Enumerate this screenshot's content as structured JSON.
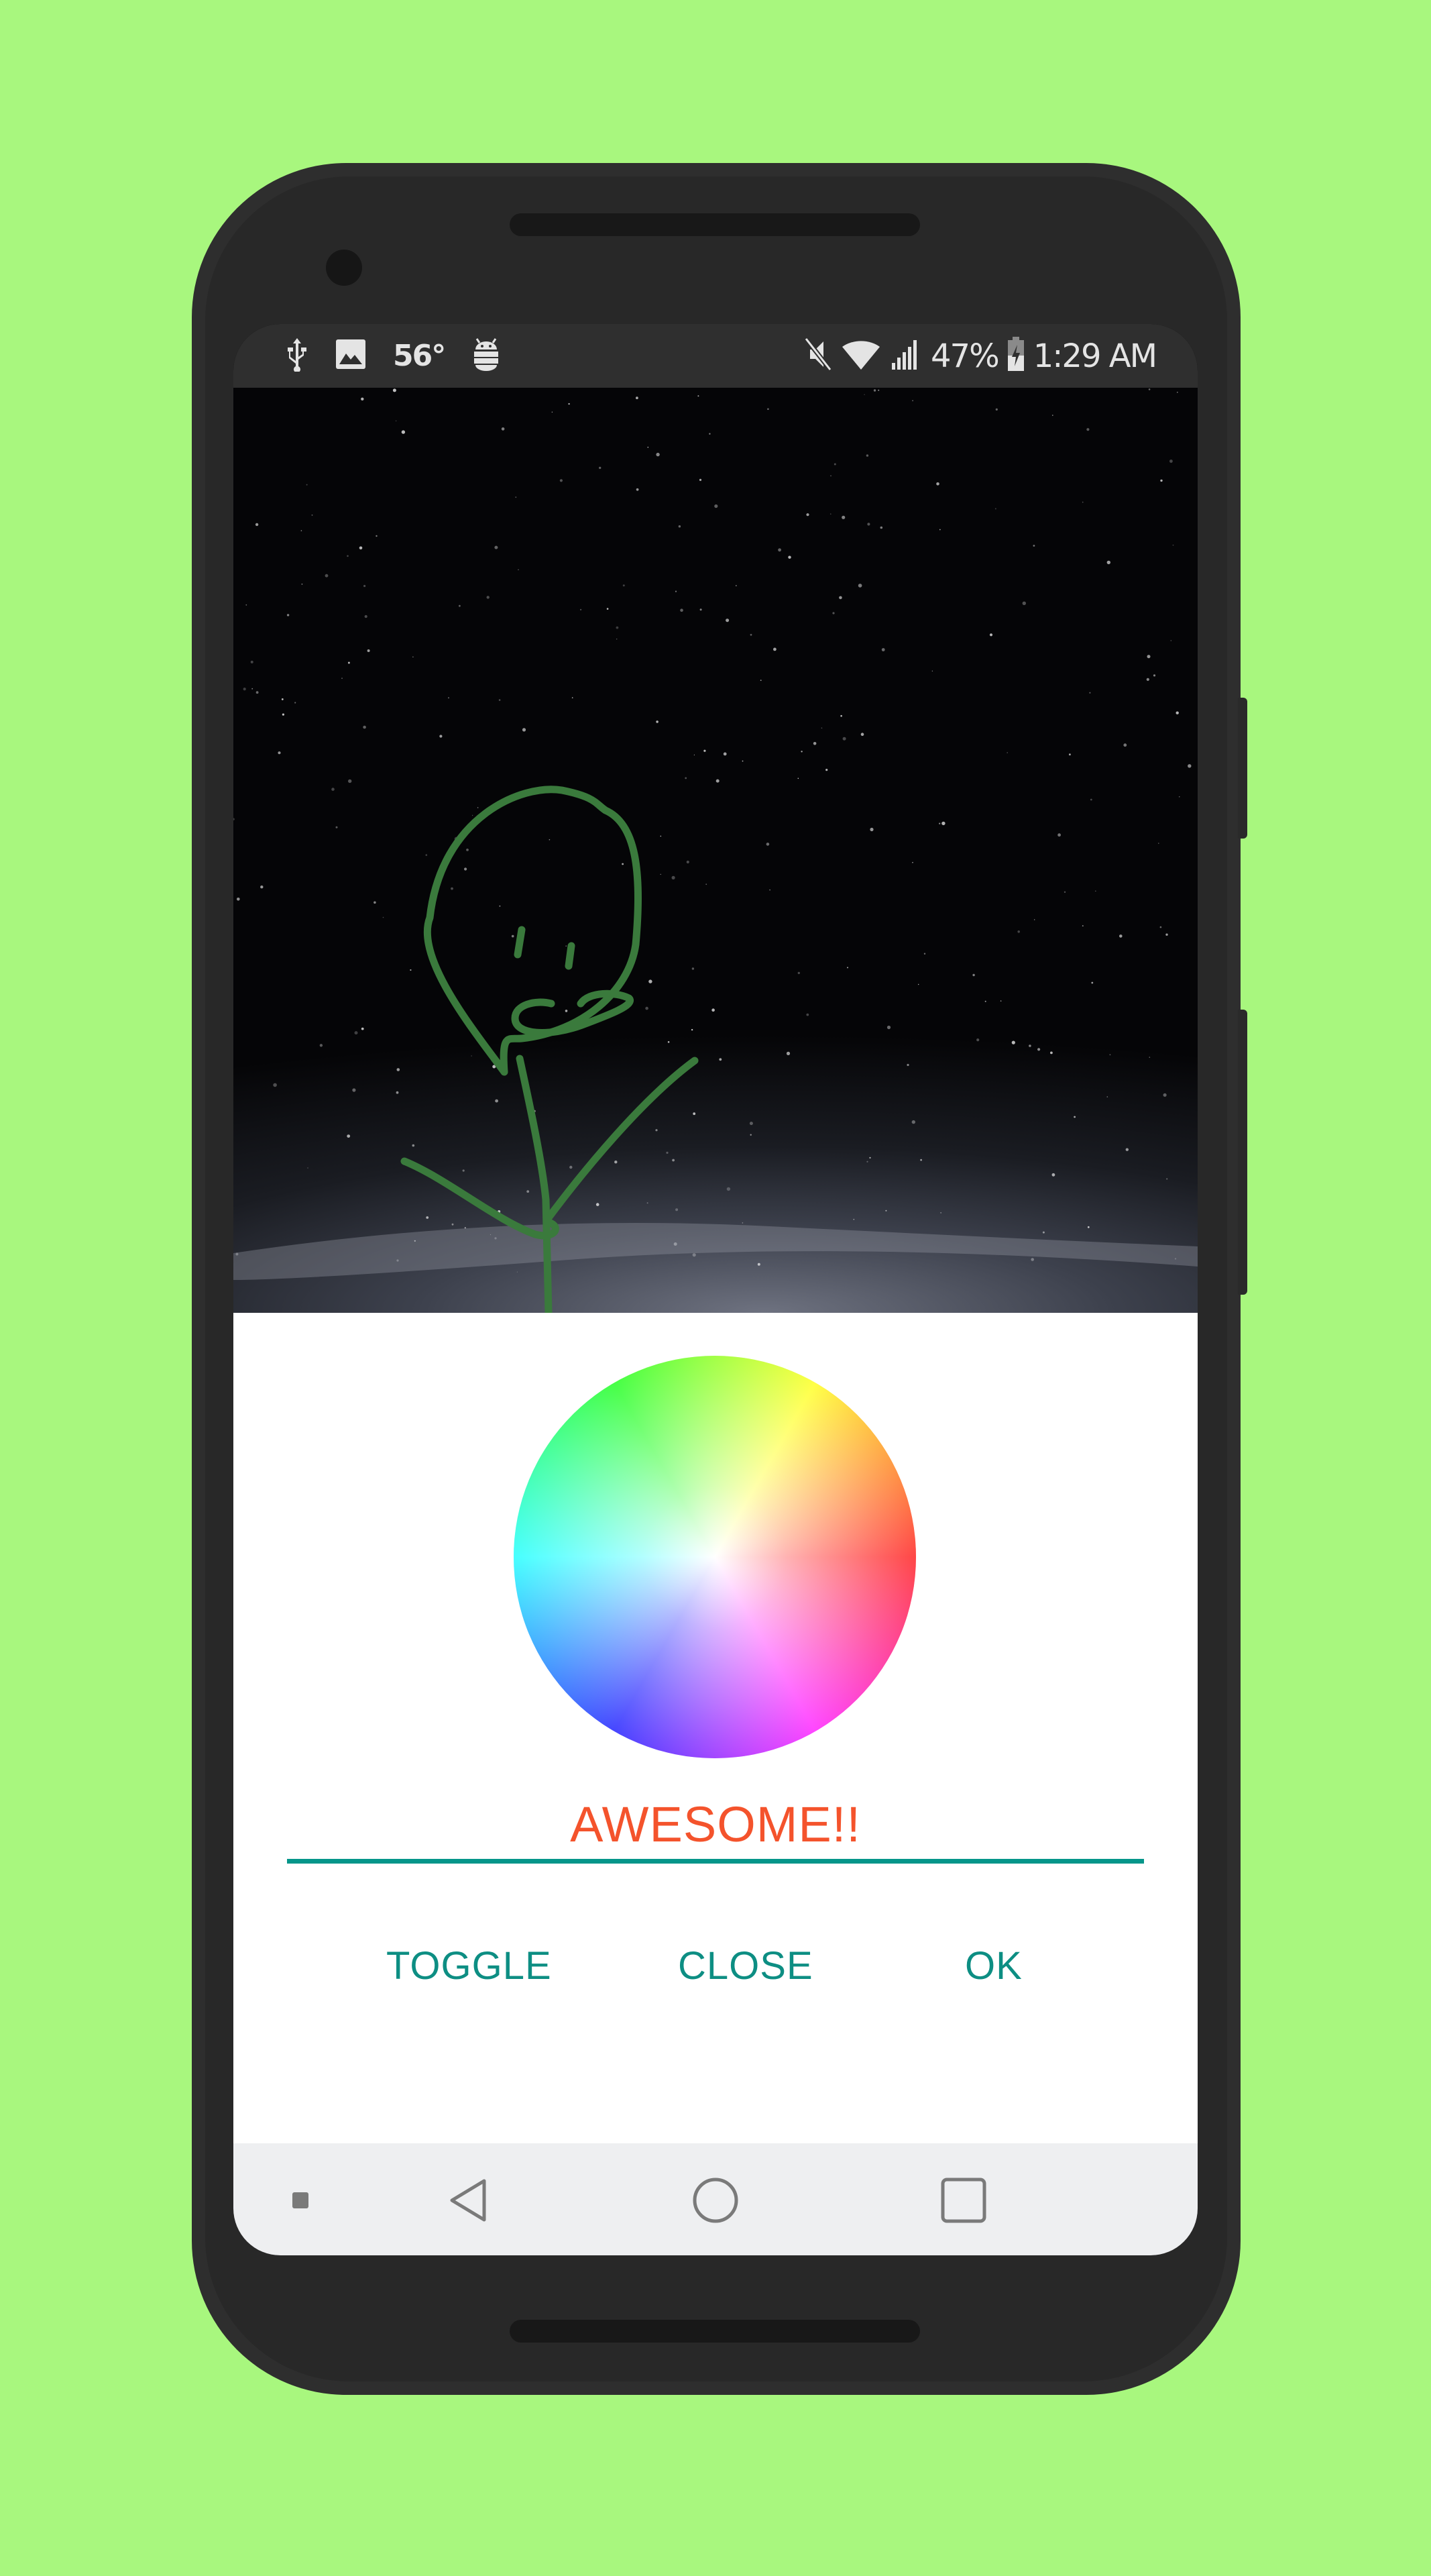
{
  "status_bar": {
    "left_icons": [
      "usb-icon",
      "image-icon",
      "weather-temp",
      "android-debug-icon"
    ],
    "temperature": "56°",
    "right_icons": [
      "mute-icon",
      "wifi-icon",
      "cell-signal-icon",
      "battery-charging-icon"
    ],
    "battery": "47%",
    "time": "1:29 AM"
  },
  "canvas": {
    "background": "starry night sky photo",
    "drawing": "green stick figure",
    "stroke_color": "#3a7a3c"
  },
  "color_picker": {
    "type": "color-wheel",
    "input_value": "AWESOME!!",
    "input_color": "#f4532c",
    "underline_color": "#05968a",
    "buttons": [
      {
        "id": "toggle",
        "label": "TOGGLE"
      },
      {
        "id": "close",
        "label": "CLOSE"
      },
      {
        "id": "ok",
        "label": "OK"
      }
    ],
    "button_color": "#0d8e83"
  },
  "nav_bar": {
    "items": [
      "overflow-dot",
      "back-icon",
      "home-icon",
      "recents-icon"
    ]
  },
  "theme": {
    "background": "#a8f77e",
    "phone_body": "#282828"
  }
}
